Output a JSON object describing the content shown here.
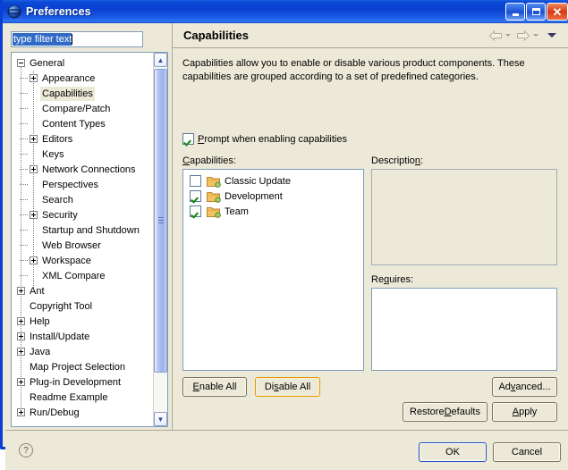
{
  "window": {
    "title": "Preferences",
    "icon": "eclipse-globe-icon",
    "minimize_label": "Minimize",
    "maximize_label": "Maximize",
    "close_label": "Close",
    "close_glyph": "✕"
  },
  "filter": {
    "value": "type filter text",
    "placeholder": "type filter text"
  },
  "tree": {
    "items": [
      {
        "label": "General",
        "level": 0,
        "expander": "minus"
      },
      {
        "label": "Appearance",
        "level": 1,
        "expander": "plus"
      },
      {
        "label": "Capabilities",
        "level": 1,
        "expander": "none",
        "selected": true
      },
      {
        "label": "Compare/Patch",
        "level": 1,
        "expander": "none"
      },
      {
        "label": "Content Types",
        "level": 1,
        "expander": "none"
      },
      {
        "label": "Editors",
        "level": 1,
        "expander": "plus"
      },
      {
        "label": "Keys",
        "level": 1,
        "expander": "none"
      },
      {
        "label": "Network Connections",
        "level": 1,
        "expander": "plus"
      },
      {
        "label": "Perspectives",
        "level": 1,
        "expander": "none"
      },
      {
        "label": "Search",
        "level": 1,
        "expander": "none"
      },
      {
        "label": "Security",
        "level": 1,
        "expander": "plus"
      },
      {
        "label": "Startup and Shutdown",
        "level": 1,
        "expander": "none"
      },
      {
        "label": "Web Browser",
        "level": 1,
        "expander": "none"
      },
      {
        "label": "Workspace",
        "level": 1,
        "expander": "plus"
      },
      {
        "label": "XML Compare",
        "level": 1,
        "expander": "none"
      },
      {
        "label": "Ant",
        "level": 0,
        "expander": "plus"
      },
      {
        "label": "Copyright Tool",
        "level": 0,
        "expander": "none"
      },
      {
        "label": "Help",
        "level": 0,
        "expander": "plus"
      },
      {
        "label": "Install/Update",
        "level": 0,
        "expander": "plus"
      },
      {
        "label": "Java",
        "level": 0,
        "expander": "plus"
      },
      {
        "label": "Map Project Selection",
        "level": 0,
        "expander": "none"
      },
      {
        "label": "Plug-in Development",
        "level": 0,
        "expander": "plus"
      },
      {
        "label": "Readme Example",
        "level": 0,
        "expander": "none"
      },
      {
        "label": "Run/Debug",
        "level": 0,
        "expander": "plus"
      }
    ],
    "scroll_up_glyph": "▲",
    "scroll_down_glyph": "▼"
  },
  "page": {
    "title": "Capabilities",
    "nav_back": "back-arrow",
    "nav_forward": "forward-arrow",
    "nav_menu": "view-menu",
    "description": "Capabilities allow you to enable or disable various product components.  These capabilities are grouped according to a set of predefined categories.",
    "prompt_checkbox": {
      "label_prefix": "P",
      "label_rest": "rompt when enabling capabilities",
      "checked": true
    },
    "capabilities_label_prefix": "C",
    "capabilities_label_rest": "apabilities:",
    "capabilities": [
      {
        "label": "Classic Update",
        "checked": false
      },
      {
        "label": "Development",
        "checked": true
      },
      {
        "label": "Team",
        "checked": true
      }
    ],
    "description_label_prefix": "Descriptio",
    "description_label_mid": "n",
    "description_label_suffix": ":",
    "description_value": "",
    "requires_label_prefix": "Re",
    "requires_label_mid": "q",
    "requires_label_suffix": "uires:",
    "requires_value": "",
    "buttons": {
      "enable_all": {
        "prefix": "",
        "mnemonic": "E",
        "rest": "nable All"
      },
      "disable_all": {
        "prefix": "Di",
        "mnemonic": "s",
        "rest": "able All",
        "focused": true
      },
      "advanced": {
        "prefix": "Ad",
        "mnemonic": "v",
        "rest": "anced..."
      },
      "restore_defaults": {
        "prefix": "Restore ",
        "mnemonic": "D",
        "rest": "efaults"
      },
      "apply": {
        "prefix": "",
        "mnemonic": "A",
        "rest": "pply"
      }
    }
  },
  "footer": {
    "help_glyph": "?",
    "ok_label": "OK",
    "cancel_label": "Cancel"
  },
  "colors": {
    "title_bar": "#0b49d6",
    "dialog_face": "#ece9d8",
    "selection": "#316ac5",
    "focus_border": "#e59700",
    "default_button_border": "#1d4fbb",
    "check_green": "#13850f"
  }
}
